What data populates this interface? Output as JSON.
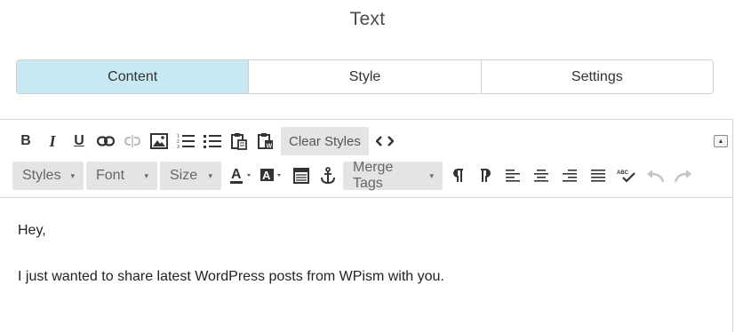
{
  "panel": {
    "title": "Text"
  },
  "tabs": [
    {
      "label": "Content",
      "active": true
    },
    {
      "label": "Style",
      "active": false
    },
    {
      "label": "Settings",
      "active": false
    }
  ],
  "toolbar": {
    "bold_label": "B",
    "italic_label": "I",
    "underline_label": "U",
    "clear_styles_label": "Clear Styles",
    "styles_label": "Styles",
    "font_label": "Font",
    "size_label": "Size",
    "merge_tags_label": "Merge Tags",
    "caret": "▾",
    "collapse_glyph": "▲"
  },
  "content": {
    "lines": [
      "Hey,",
      "I just wanted to share latest WordPress posts from WPism with you."
    ]
  },
  "colors": {
    "active_tab_bg": "#c8e9f4",
    "button_gray": "#e4e4e4",
    "border": "#cfcfcf",
    "icon": "#333333",
    "disabled_icon": "#c4c4c4"
  }
}
